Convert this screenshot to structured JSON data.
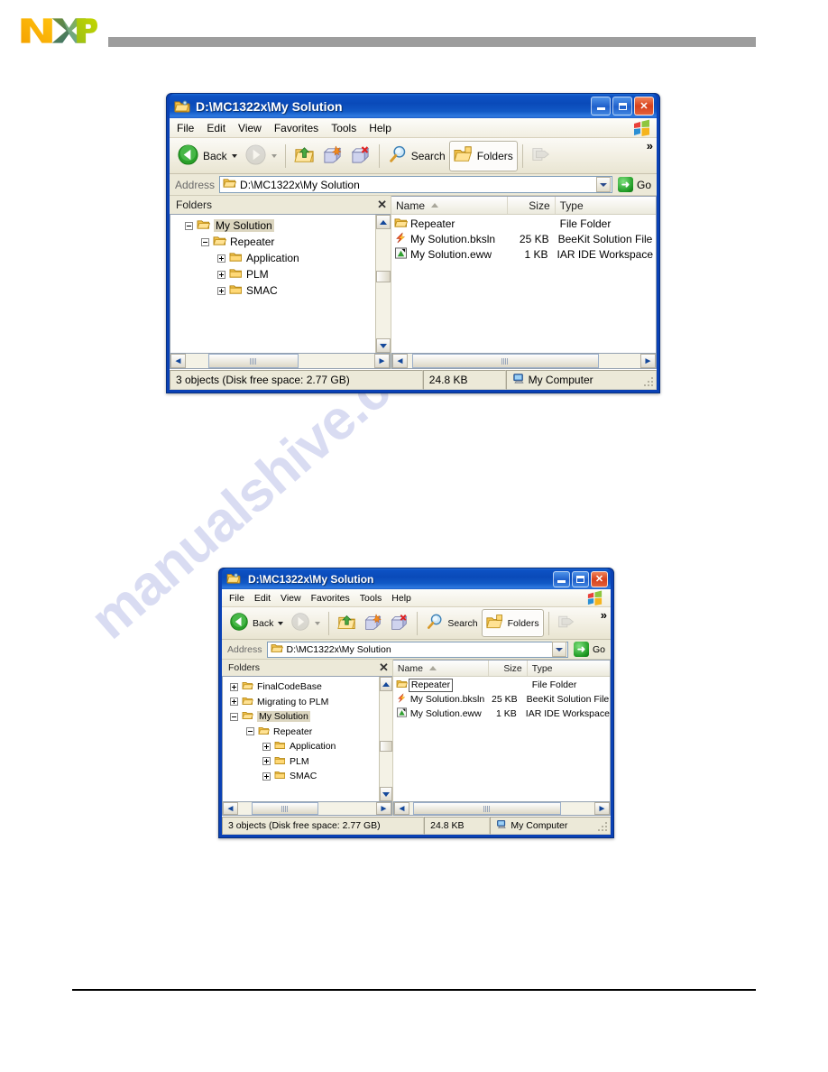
{
  "page": {
    "logo_alt": "NXP",
    "watermark_text": "manualshive.com"
  },
  "windows": [
    {
      "id": "window-top",
      "title": "D:\\MC1322x\\My Solution",
      "menu": [
        "File",
        "Edit",
        "View",
        "Favorites",
        "Tools",
        "Help"
      ],
      "toolbar": {
        "back_label": "Back",
        "search_label": "Search",
        "folders_label": "Folders",
        "chevron": "»"
      },
      "address": {
        "label": "Address",
        "value": "D:\\MC1322x\\My Solution",
        "go_label": "Go"
      },
      "tree": {
        "header": "Folders",
        "close": "✕",
        "items": [
          {
            "label": "My Solution",
            "indent": 1,
            "expander": "minus",
            "selected": true
          },
          {
            "label": "Repeater",
            "indent": 2,
            "expander": "minus",
            "selected": false
          },
          {
            "label": "Application",
            "indent": 3,
            "expander": "plus",
            "selected": false
          },
          {
            "label": "PLM",
            "indent": 3,
            "expander": "plus",
            "selected": false
          },
          {
            "label": "SMAC",
            "indent": 3,
            "expander": "plus",
            "selected": false
          }
        ]
      },
      "list": {
        "columns": [
          "Name",
          "Size",
          "Type"
        ],
        "sorted_by": "Name",
        "rows": [
          {
            "icon": "folder-icon",
            "name": "Repeater",
            "size": "",
            "type": "File Folder",
            "editing": false
          },
          {
            "icon": "beekit-solution-icon",
            "name": "My Solution.bksln",
            "size": "25 KB",
            "type": "BeeKit Solution File",
            "editing": false
          },
          {
            "icon": "iar-workspace-icon",
            "name": "My Solution.eww",
            "size": "1 KB",
            "type": "IAR IDE Workspace",
            "editing": false
          }
        ]
      },
      "status": {
        "objects": "3 objects (Disk free space: 2.77 GB)",
        "size": "24.8 KB",
        "location": "My Computer"
      }
    },
    {
      "id": "window-bottom",
      "title": "D:\\MC1322x\\My Solution",
      "menu": [
        "File",
        "Edit",
        "View",
        "Favorites",
        "Tools",
        "Help"
      ],
      "toolbar": {
        "back_label": "Back",
        "search_label": "Search",
        "folders_label": "Folders",
        "chevron": "»"
      },
      "address": {
        "label": "Address",
        "value": "D:\\MC1322x\\My Solution",
        "go_label": "Go"
      },
      "tree": {
        "header": "Folders",
        "close": "✕",
        "items": [
          {
            "label": "FinalCodeBase",
            "indent": 1,
            "expander": "plus",
            "selected": false
          },
          {
            "label": "Migrating to PLM",
            "indent": 1,
            "expander": "plus",
            "selected": false
          },
          {
            "label": "My Solution",
            "indent": 1,
            "expander": "minus",
            "selected": true
          },
          {
            "label": "Repeater",
            "indent": 2,
            "expander": "minus",
            "selected": false
          },
          {
            "label": "Application",
            "indent": 3,
            "expander": "plus",
            "selected": false
          },
          {
            "label": "PLM",
            "indent": 3,
            "expander": "plus",
            "selected": false
          },
          {
            "label": "SMAC",
            "indent": 3,
            "expander": "plus",
            "selected": false
          }
        ]
      },
      "list": {
        "columns": [
          "Name",
          "Size",
          "Type"
        ],
        "sorted_by": "Name",
        "rows": [
          {
            "icon": "folder-icon",
            "name": "Repeater",
            "size": "",
            "type": "File Folder",
            "editing": true
          },
          {
            "icon": "beekit-solution-icon",
            "name": "My Solution.bksln",
            "size": "25 KB",
            "type": "BeeKit Solution File",
            "editing": false
          },
          {
            "icon": "iar-workspace-icon",
            "name": "My Solution.eww",
            "size": "1 KB",
            "type": "IAR IDE Workspace",
            "editing": false
          }
        ]
      },
      "status": {
        "objects": "3 objects (Disk free space: 2.77 GB)",
        "size": "24.8 KB",
        "location": "My Computer"
      }
    }
  ],
  "colors": {
    "titlebar_blue": "#0a41b5",
    "client_beige": "#ece9d8",
    "selection": "#dcd6c0",
    "nxp_orange": "#f7a81b",
    "nxp_green": "#a8c700",
    "header_gray": "#9d9d9d"
  }
}
